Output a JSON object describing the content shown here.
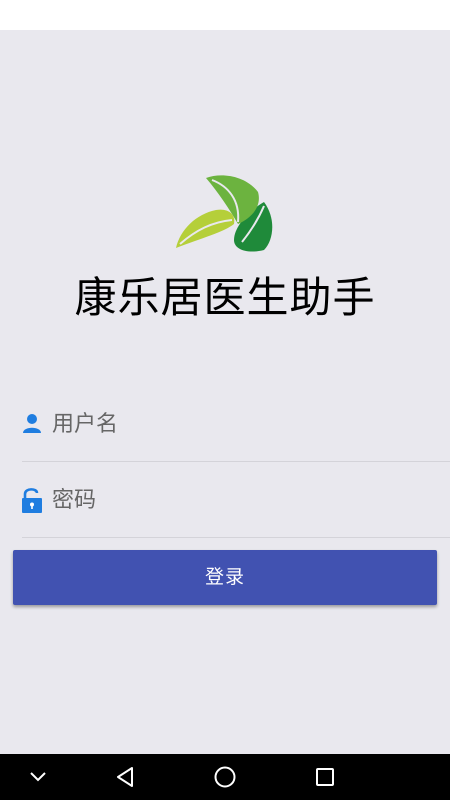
{
  "app": {
    "title": "康乐居医生助手",
    "logo_icon": "leaf-logo-icon"
  },
  "login_form": {
    "username": {
      "placeholder": "用户名",
      "value": "",
      "icon": "user-icon"
    },
    "password": {
      "placeholder": "密码",
      "value": "",
      "icon": "lock-icon"
    },
    "submit_label": "登录"
  },
  "colors": {
    "background": "#e9e8ee",
    "button": "#4152b1",
    "icon_blue": "#1f7de0",
    "leaf_light": "#b5cf3a",
    "leaf_mid": "#6cb33f",
    "leaf_dark": "#1f8a3a"
  },
  "navigation_bar": {
    "buttons": [
      "chevron-down-icon",
      "back-triangle-icon",
      "home-circle-icon",
      "recents-square-icon"
    ]
  }
}
